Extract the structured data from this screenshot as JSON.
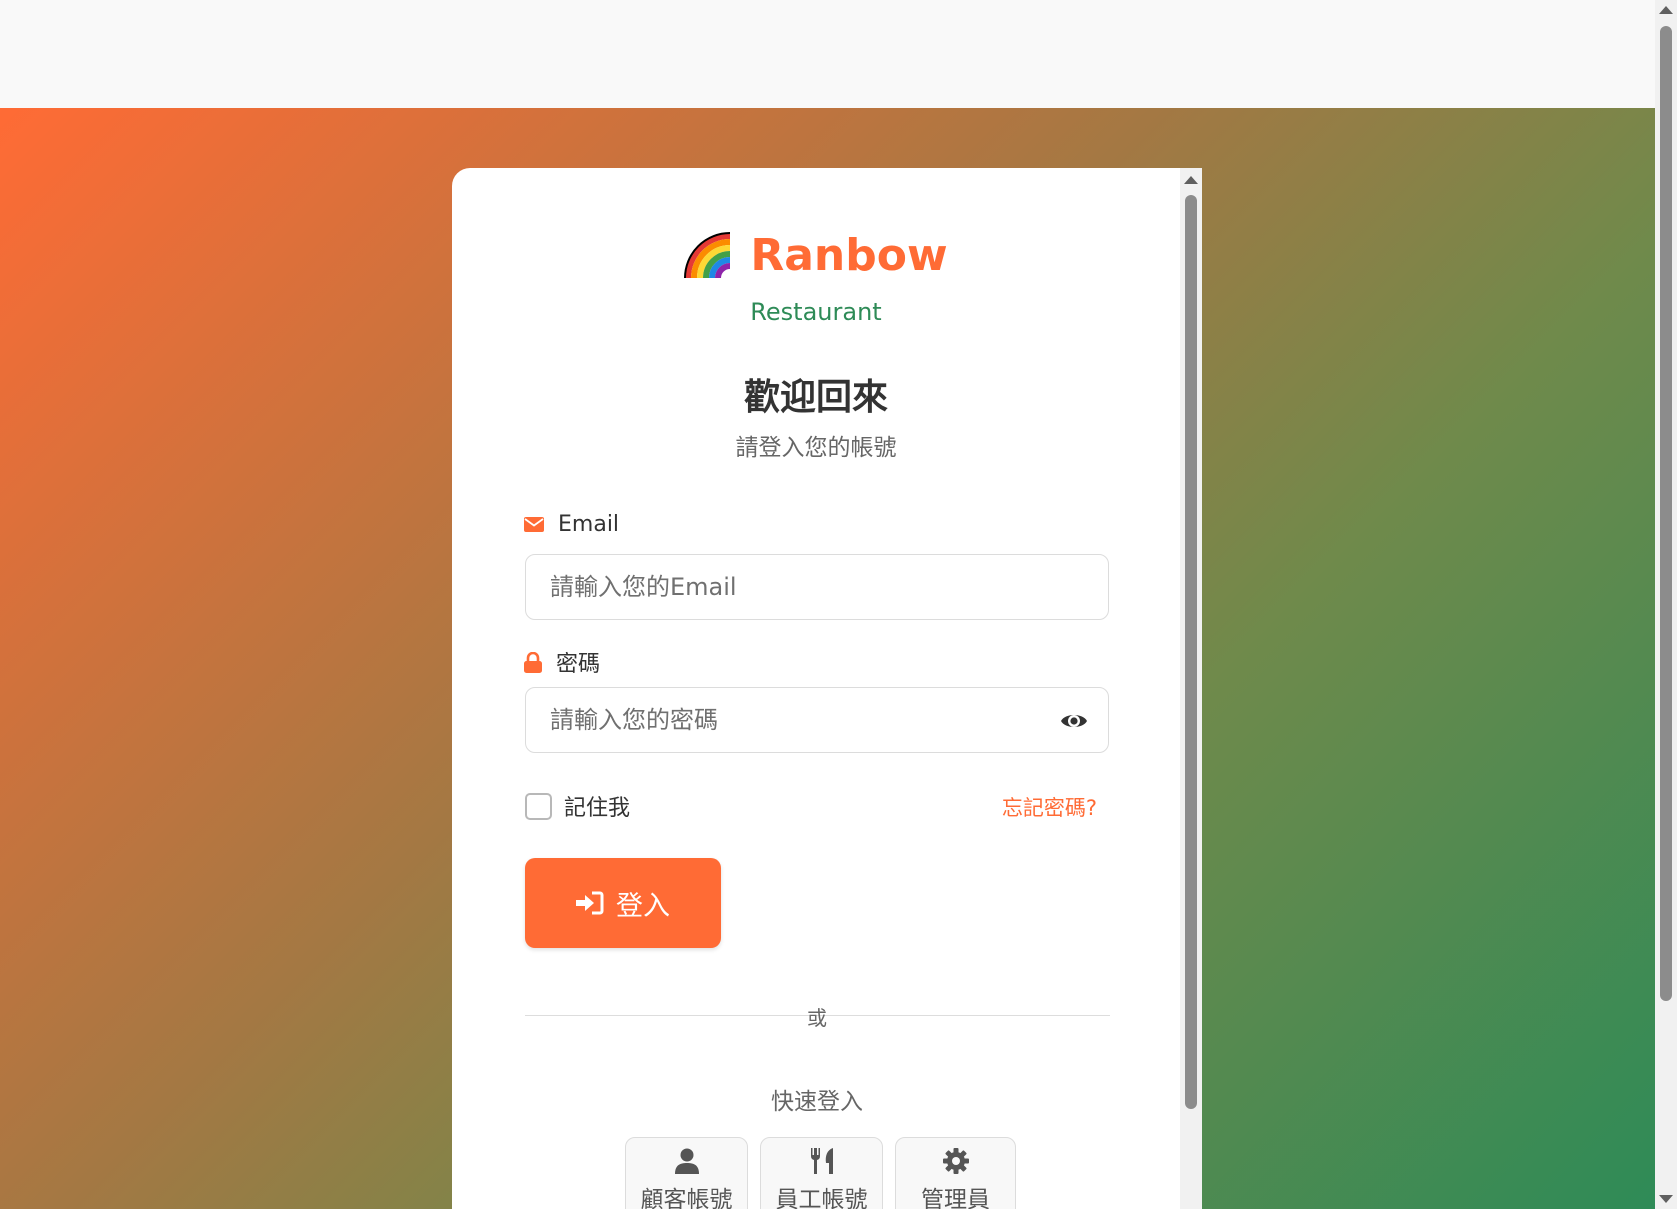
{
  "brand": {
    "name": "Ranbow",
    "subtitle": "Restaurant"
  },
  "welcome": {
    "title": "歡迎回來",
    "subtitle": "請登入您的帳號"
  },
  "form": {
    "email_label": "Email",
    "email_placeholder": "請輸入您的Email",
    "password_label": "密碼",
    "password_placeholder": "請輸入您的密碼",
    "remember_label": "記住我",
    "forgot_link": "忘記密碼?",
    "login_label": "登入"
  },
  "divider": {
    "text": "或"
  },
  "quick_login": {
    "title": "快速登入",
    "buttons": [
      {
        "label": "顧客帳號",
        "icon": "user-icon"
      },
      {
        "label": "員工帳號",
        "icon": "utensils-icon"
      },
      {
        "label": "管理員",
        "icon": "gear-icon"
      }
    ]
  },
  "colors": {
    "accent": "#ff6b35",
    "secondary": "#2e8b57"
  }
}
